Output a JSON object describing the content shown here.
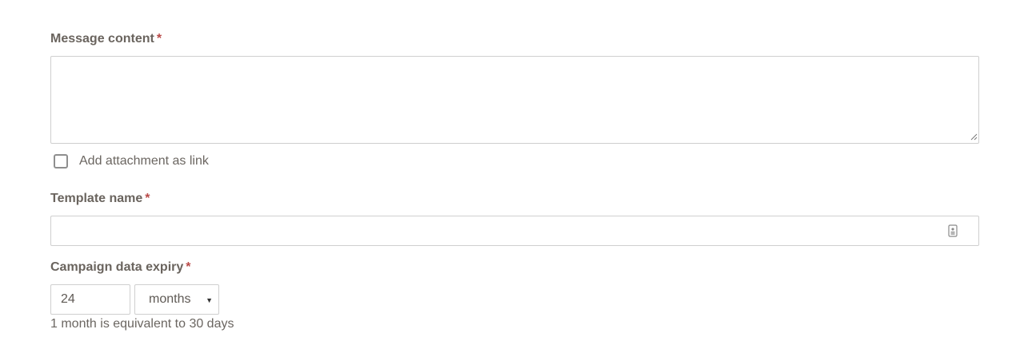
{
  "message_content": {
    "label": "Message content",
    "required_mark": "*",
    "value": ""
  },
  "attachment": {
    "label": "Add attachment as link",
    "checked": false
  },
  "template_name": {
    "label": "Template name",
    "required_mark": "*",
    "value": "",
    "autofill_icon": "contact-card-icon"
  },
  "campaign_expiry": {
    "label": "Campaign data expiry",
    "required_mark": "*",
    "amount": "24",
    "unit": "months",
    "dropdown_icon": "caret-down-icon",
    "help_text": "1 month is equivalent to 30 days"
  },
  "colors": {
    "required": "#b94a48",
    "border": "#cfcfcf",
    "text": "#5f5a55"
  }
}
